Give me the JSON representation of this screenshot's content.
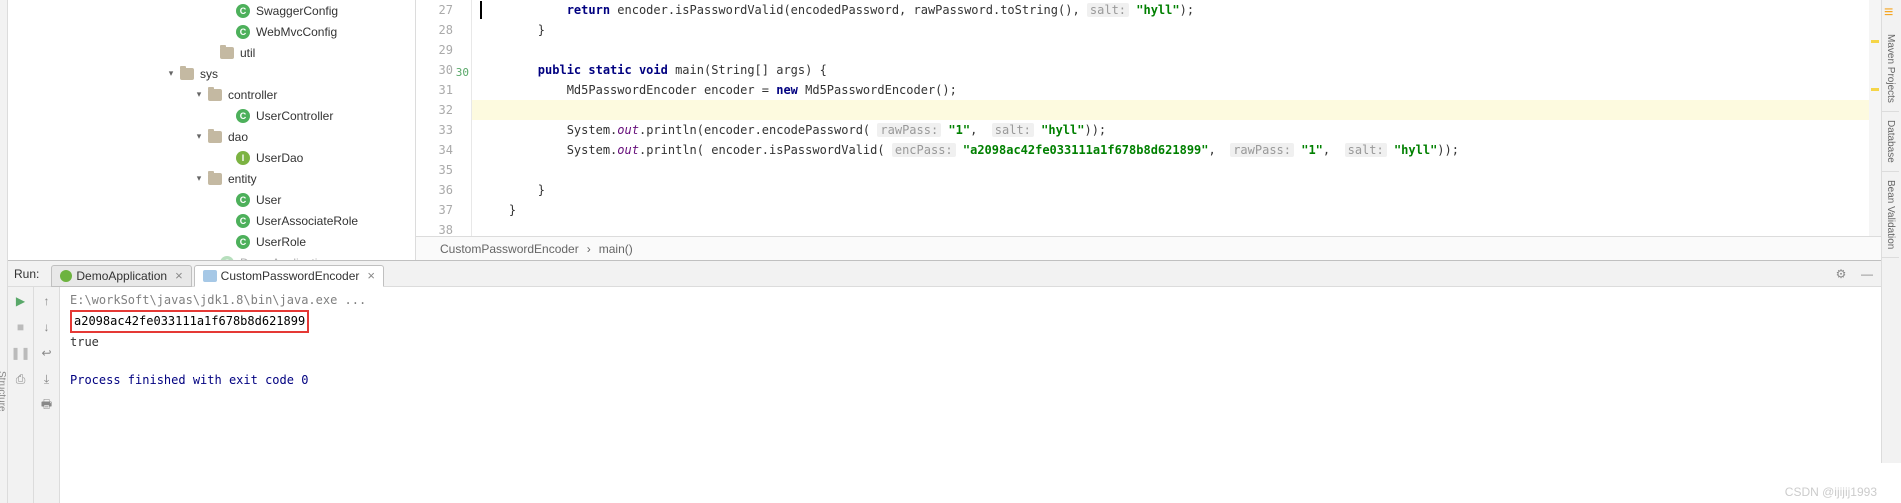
{
  "tree": {
    "swagger_config": "SwaggerConfig",
    "webmvc_config": "WebMvcConfig",
    "util": "util",
    "sys": "sys",
    "controller": "controller",
    "user_controller": "UserController",
    "dao": "dao",
    "user_dao": "UserDao",
    "entity": "entity",
    "user": "User",
    "user_assoc_role": "UserAssociateRole",
    "user_role": "UserRole",
    "demo_app": "DemoApplication"
  },
  "gutter": [
    "27",
    "28",
    "29",
    "30",
    "31",
    "32",
    "33",
    "34",
    "35",
    "36",
    "37",
    "38"
  ],
  "code": {
    "l27_return": "return",
    "l27_call": " encoder.isPasswordValid(encodedPassword, rawPassword.toString(), ",
    "l27_hint": "salt:",
    "l27_str": " \"hyll\"",
    "l27_end": ");",
    "l28": "}",
    "l30_public": "public",
    "l30_static": " static",
    "l30_void": " void",
    "l30_main": " main(String[] args) {",
    "l31_a": "Md5PasswordEncoder encoder = ",
    "l31_new": "new",
    "l31_b": " Md5PasswordEncoder();",
    "l33_a": "System.",
    "l33_out": "out",
    "l33_b": ".println(encoder.encodePassword( ",
    "l33_h1": "rawPass:",
    "l33_s1": " \"1\"",
    "l33_c": ",  ",
    "l33_h2": "salt:",
    "l33_s2": " \"hyll\"",
    "l33_d": "));",
    "l34_a": "System.",
    "l34_out": "out",
    "l34_b": ".println( encoder.isPasswordValid( ",
    "l34_h1": "encPass:",
    "l34_s1": " \"a2098ac42fe033111a1f678b8d621899\"",
    "l34_c": ",  ",
    "l34_h2": "rawPass:",
    "l34_s2": " \"1\"",
    "l34_d": ",  ",
    "l34_h3": "salt:",
    "l34_s3": " \"hyll\"",
    "l34_e": "));",
    "l36": "}",
    "l37": "}"
  },
  "breadcrumb": {
    "a": "CustomPasswordEncoder",
    "b": "main()"
  },
  "right_tabs": {
    "maven": "Maven Projects",
    "db": "Database",
    "bean": "Bean Validation"
  },
  "run": {
    "title": "Run:",
    "tab1": "DemoApplication",
    "tab2": "CustomPasswordEncoder",
    "path": "E:\\workSoft\\javas\\jdk1.8\\bin\\java.exe ...",
    "hash": "a2098ac42fe033111a1f678b8d621899",
    "true": "true",
    "exit": "Process finished with exit code 0"
  },
  "sidebar_left": "Structure",
  "watermark": "CSDN @ijijij1993"
}
